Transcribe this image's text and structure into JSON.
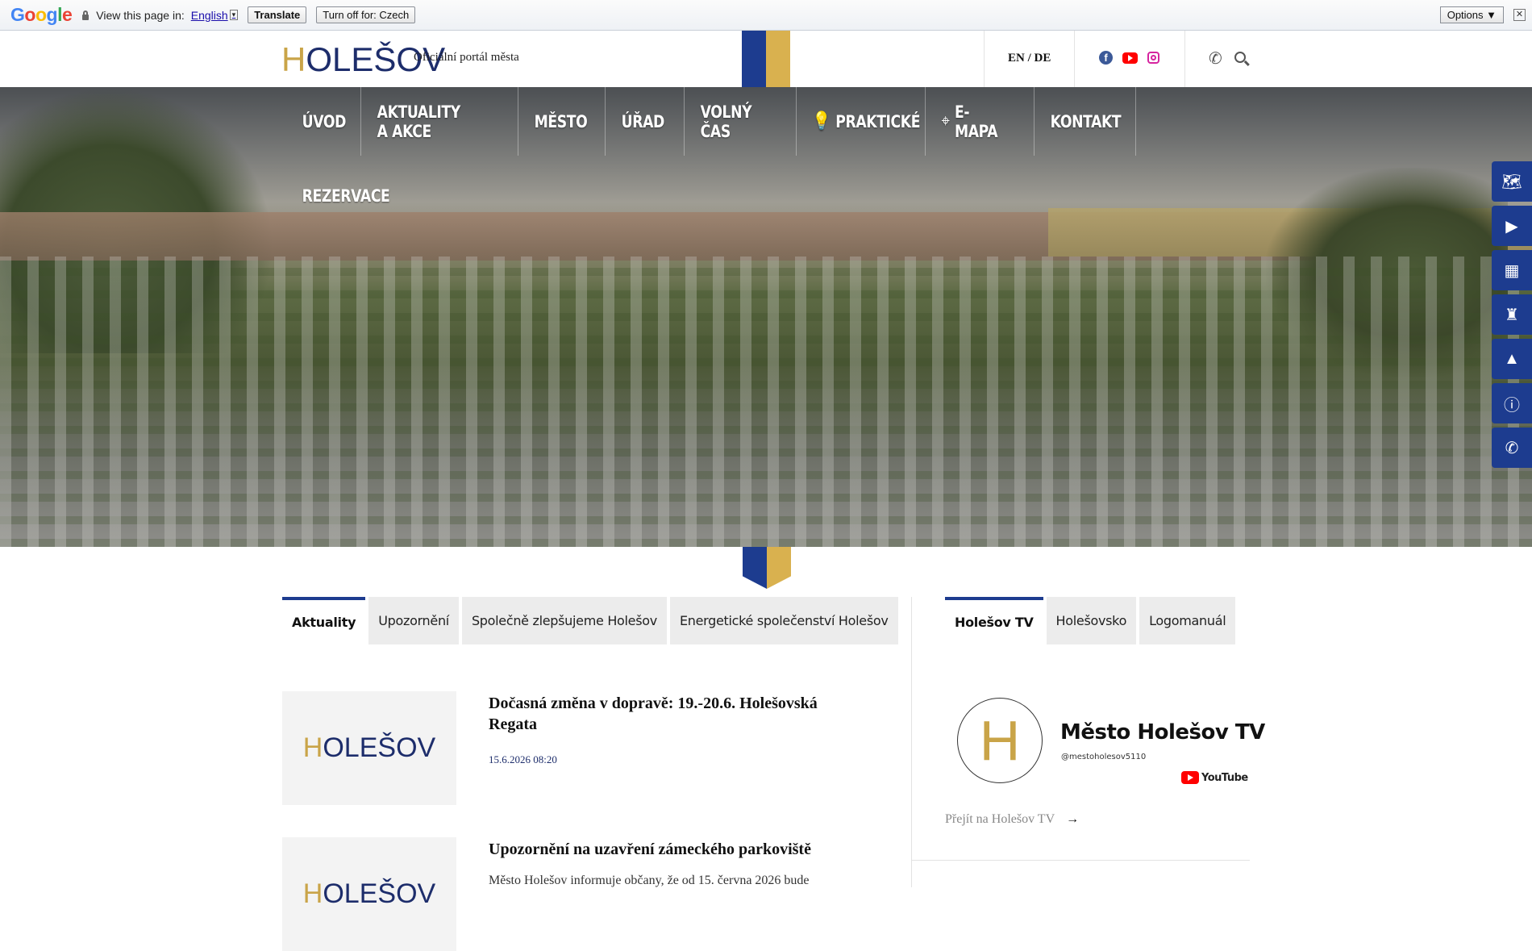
{
  "translate_bar": {
    "logo": "Google",
    "view_text": "View this page in:",
    "language": "English",
    "translate_button": "Translate",
    "turn_off_button": "Turn off for: Czech",
    "options_button": "Options ▼",
    "close": "✕"
  },
  "header": {
    "logo": "HOLEŠOV",
    "tagline": "Oficiální portál města",
    "languages": "EN / DE",
    "social": [
      "facebook-icon",
      "youtube-icon",
      "instagram-icon"
    ]
  },
  "nav": {
    "items": [
      {
        "label": "Úvod"
      },
      {
        "label": "Aktuality a akce"
      },
      {
        "label": "Město"
      },
      {
        "label": "Úřad"
      },
      {
        "label": "Volný čas"
      },
      {
        "label": "Praktické"
      },
      {
        "label": "E-mapa"
      },
      {
        "label": "Kontakt"
      },
      {
        "label": "Rezervace"
      }
    ]
  },
  "quick_links": [
    "map-icon",
    "video-icon",
    "calendar-icon",
    "castle-icon",
    "bell-icon",
    "info-icon",
    "phone-icon"
  ],
  "news_tabs": [
    "Aktuality",
    "Upozornění",
    "Společně zlepšujeme Holešov",
    "Energetické společenství Holešov"
  ],
  "news": [
    {
      "title": "Dočasná změna v dopravě: 19.-20.6. Holešovská Regata",
      "date": "15.6.2026 08:20",
      "thumb_logo": "HOLEŠOV"
    },
    {
      "title": "Upozornění na uzavření zámeckého parkoviště",
      "excerpt": "Město Holešov informuje občany, že od 15. června 2026 bude",
      "thumb_logo": "HOLEŠOV"
    }
  ],
  "side_tabs": [
    "Holešov TV",
    "Holešovsko",
    "Logomanuál"
  ],
  "tv": {
    "monogram": "H",
    "title": "Město Holešov TV",
    "handle": "@mestoholesov5110",
    "yt_label": "YouTube",
    "link": "Přejít na Holešov TV",
    "arrow": "→"
  },
  "colors": {
    "brand_blue": "#1d3c8f",
    "brand_gold": "#d9b14f"
  }
}
